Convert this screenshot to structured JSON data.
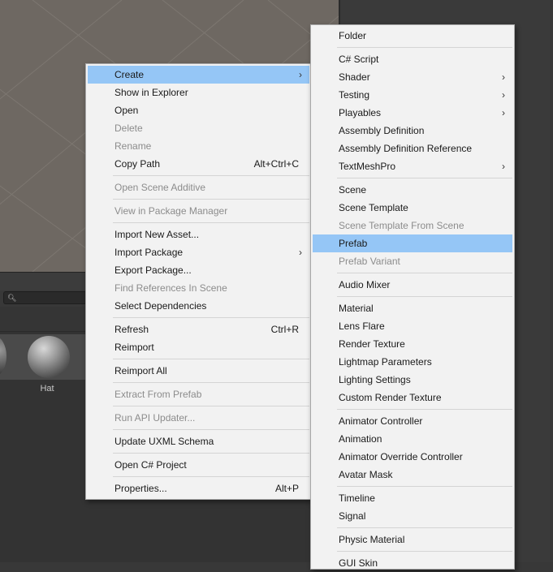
{
  "asset": {
    "label": "Hat"
  },
  "search": {
    "icon": "search-icon"
  },
  "main_menu": {
    "items": [
      {
        "label": "Create",
        "has_submenu": true,
        "highlighted": true
      },
      {
        "label": "Show in Explorer"
      },
      {
        "label": "Open"
      },
      {
        "label": "Delete",
        "disabled": true
      },
      {
        "label": "Rename",
        "disabled": true
      },
      {
        "label": "Copy Path",
        "shortcut": "Alt+Ctrl+C"
      },
      {
        "label": "Open Scene Additive",
        "disabled": true
      },
      {
        "label": "View in Package Manager",
        "disabled": true
      },
      {
        "label": "Import New Asset..."
      },
      {
        "label": "Import Package",
        "has_submenu": true
      },
      {
        "label": "Export Package..."
      },
      {
        "label": "Find References In Scene",
        "disabled": true
      },
      {
        "label": "Select Dependencies"
      },
      {
        "label": "Refresh",
        "shortcut": "Ctrl+R"
      },
      {
        "label": "Reimport"
      },
      {
        "label": "Reimport All"
      },
      {
        "label": "Extract From Prefab",
        "disabled": true
      },
      {
        "label": "Run API Updater...",
        "disabled": true
      },
      {
        "label": "Update UXML Schema"
      },
      {
        "label": "Open C# Project"
      },
      {
        "label": "Properties...",
        "shortcut": "Alt+P"
      }
    ]
  },
  "create_submenu": {
    "items": [
      {
        "label": "Folder"
      },
      {
        "label": "C# Script"
      },
      {
        "label": "Shader",
        "has_submenu": true
      },
      {
        "label": "Testing",
        "has_submenu": true
      },
      {
        "label": "Playables",
        "has_submenu": true
      },
      {
        "label": "Assembly Definition"
      },
      {
        "label": "Assembly Definition Reference"
      },
      {
        "label": "TextMeshPro",
        "has_submenu": true
      },
      {
        "label": "Scene"
      },
      {
        "label": "Scene Template"
      },
      {
        "label": "Scene Template From Scene",
        "disabled": true
      },
      {
        "label": "Prefab",
        "highlighted": true
      },
      {
        "label": "Prefab Variant",
        "disabled": true
      },
      {
        "label": "Audio Mixer"
      },
      {
        "label": "Material"
      },
      {
        "label": "Lens Flare"
      },
      {
        "label": "Render Texture"
      },
      {
        "label": "Lightmap Parameters"
      },
      {
        "label": "Lighting Settings"
      },
      {
        "label": "Custom Render Texture"
      },
      {
        "label": "Animator Controller"
      },
      {
        "label": "Animation"
      },
      {
        "label": "Animator Override Controller"
      },
      {
        "label": "Avatar Mask"
      },
      {
        "label": "Timeline"
      },
      {
        "label": "Signal"
      },
      {
        "label": "Physic Material"
      },
      {
        "label": "GUI Skin"
      }
    ]
  }
}
